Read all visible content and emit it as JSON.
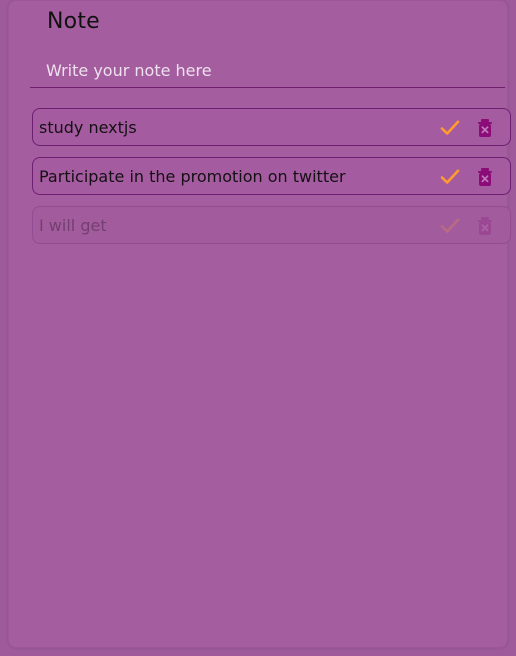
{
  "app": {
    "title": "Note"
  },
  "input": {
    "placeholder": "Write your note here",
    "value": ""
  },
  "notes": [
    {
      "text": "study nextjs"
    },
    {
      "text": "Participate in the promotion on twitter"
    },
    {
      "text": "I will get"
    }
  ],
  "icons": {
    "complete": "check-icon",
    "delete": "trash-icon"
  },
  "colors": {
    "background": "#9f5a9b",
    "panel": "#a45e9f",
    "accent": "#6d1f72",
    "check": "#ff9b2f",
    "trash": "#8b0c78"
  }
}
